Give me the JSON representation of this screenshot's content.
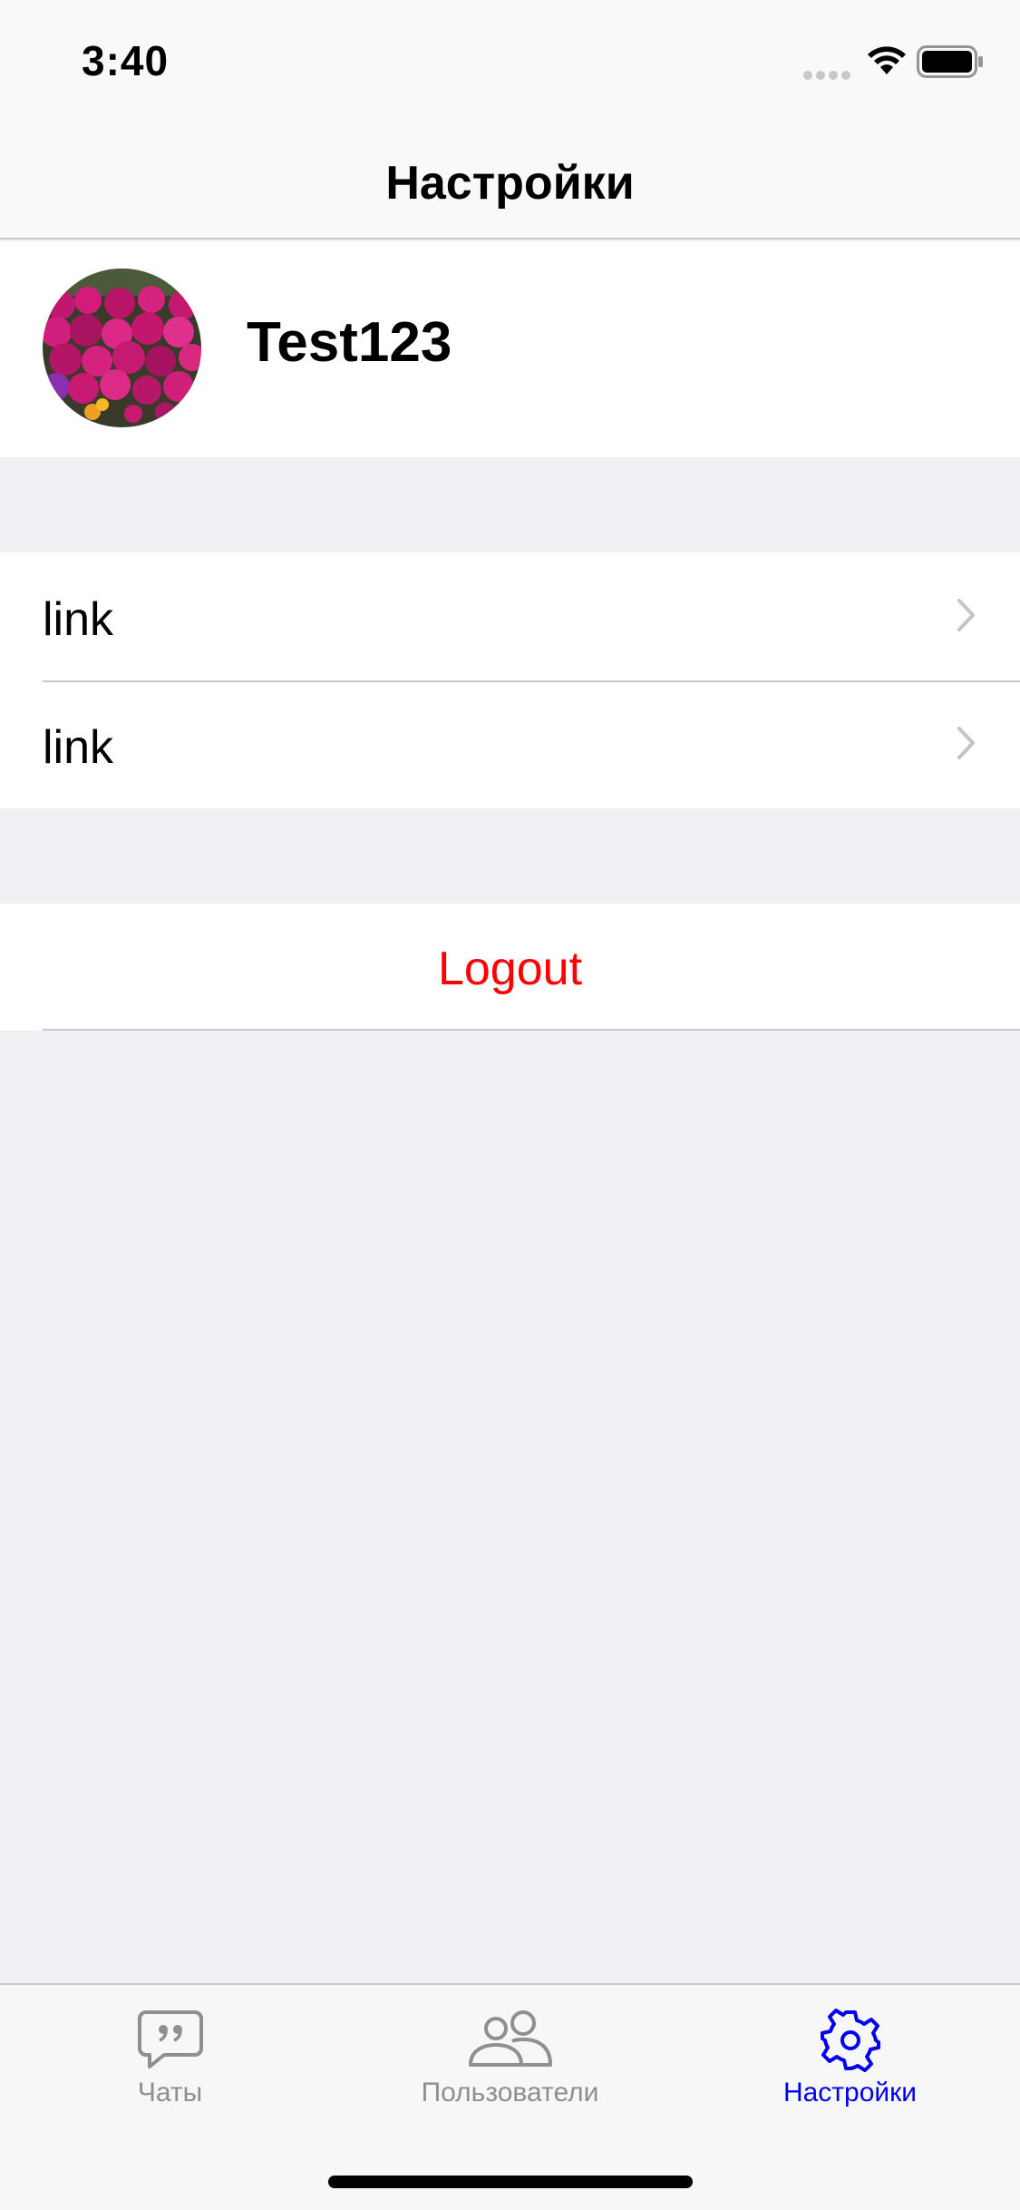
{
  "status_bar": {
    "time": "3:40",
    "icons": [
      "signal-icon",
      "wifi-icon",
      "battery-icon"
    ]
  },
  "nav": {
    "title": "Настройки"
  },
  "profile": {
    "name": "Test123",
    "avatar": "flower-bed-photo"
  },
  "links": [
    {
      "label": "link",
      "icon": "chevron-right-icon"
    },
    {
      "label": "link",
      "icon": "chevron-right-icon"
    }
  ],
  "logout": {
    "label": "Logout",
    "color": "#FF0000"
  },
  "tabs": [
    {
      "label": "Чаты",
      "icon": "chat-quote-icon",
      "selected": false
    },
    {
      "label": "Пользователи",
      "icon": "users-icon",
      "selected": false
    },
    {
      "label": "Настройки",
      "icon": "gear-icon",
      "selected": true
    }
  ],
  "colors": {
    "accent": "#0000EE",
    "destructive": "#FF0000",
    "grouped_background": "#EFEFF4",
    "separator": "#C8C7CC",
    "inactive_tab": "#8E8E93"
  }
}
